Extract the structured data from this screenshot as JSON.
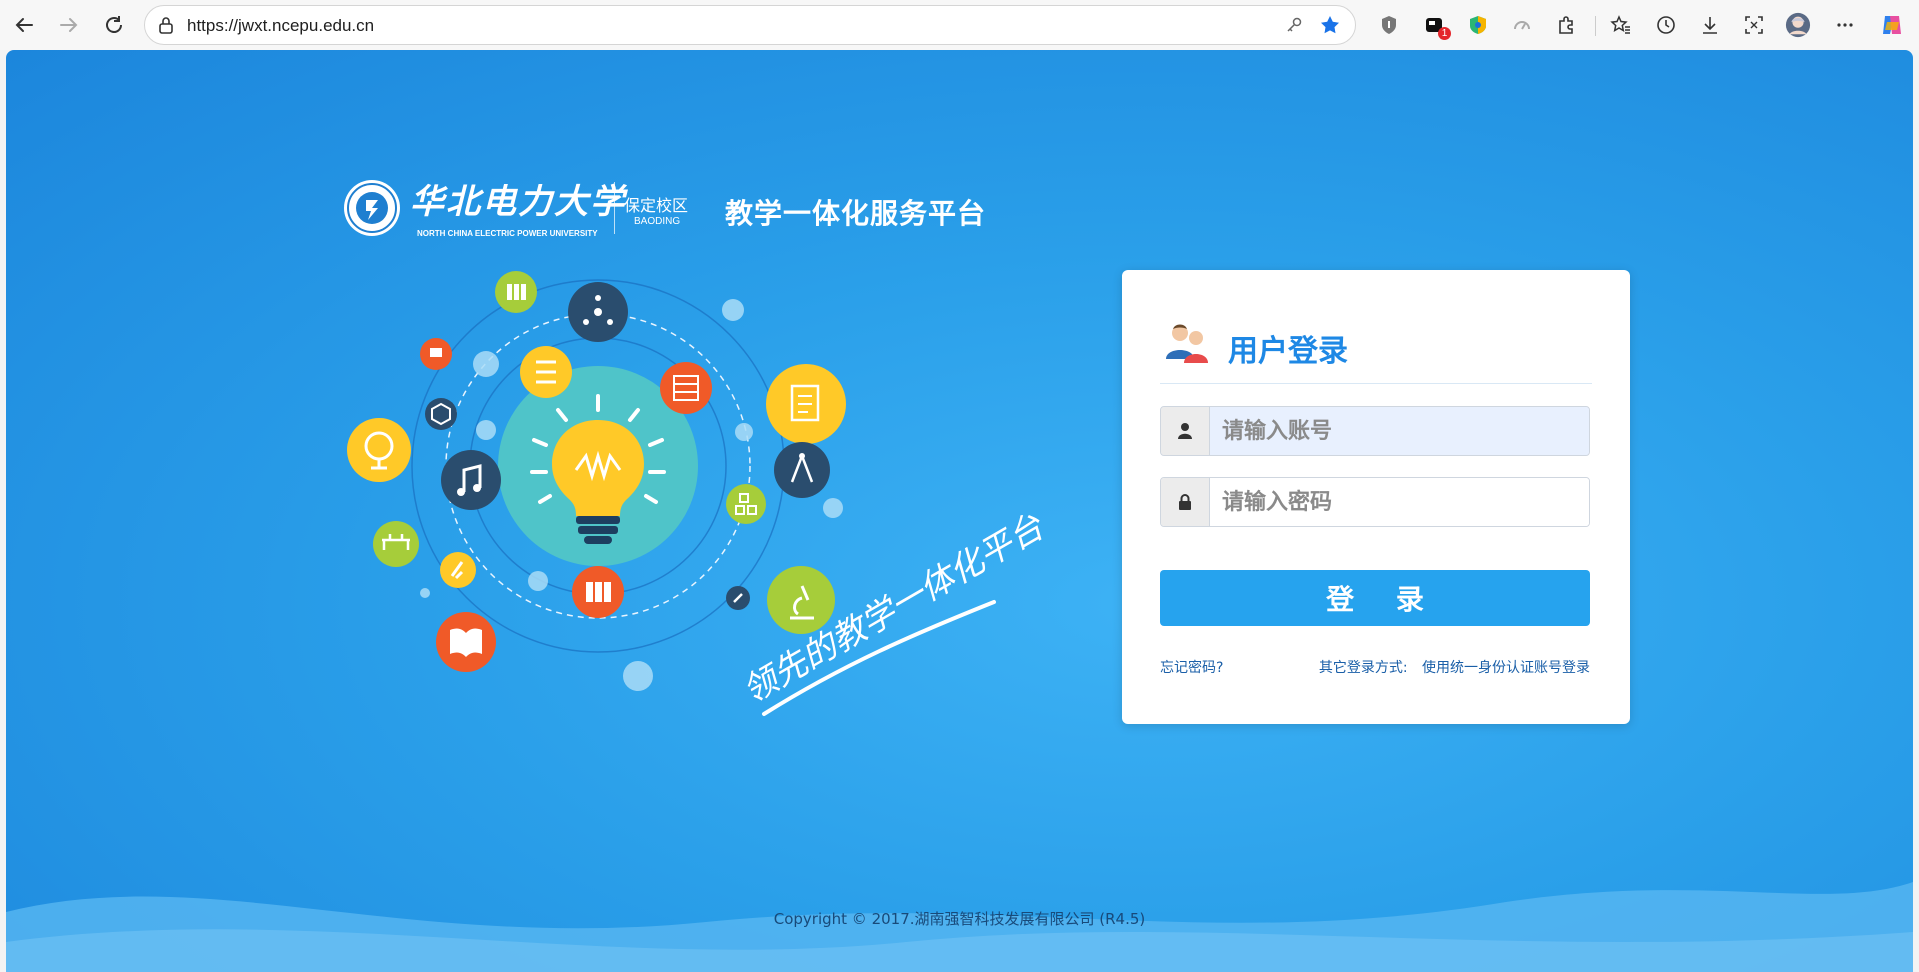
{
  "browser": {
    "url": "https://jwxt.ncepu.edu.cn",
    "extension_badge": "1"
  },
  "header": {
    "univ_name_cn": "华北电力大学",
    "univ_name_en": "NORTH CHINA ELECTRIC POWER UNIVERSITY",
    "campus_cn": "保定校区",
    "campus_en": "BAODING",
    "platform_title": "教学一体化服务平台"
  },
  "illustration": {
    "slogan": "领先的教学一体化平台"
  },
  "login": {
    "title": "用户登录",
    "username_placeholder": "请输入账号",
    "password_placeholder": "请输入密码",
    "submit_label": "登 录",
    "forgot_label": "忘记密码?",
    "other_methods_label": "其它登录方式:",
    "sso_label": "使用统一身份认证账号登录"
  },
  "footer": {
    "copyright": "Copyright © 2017.湖南强智科技发展有限公司 (R4.5)"
  },
  "colors": {
    "accent": "#26a3ee",
    "title": "#1e88e5",
    "background": "#2a9fe9"
  }
}
